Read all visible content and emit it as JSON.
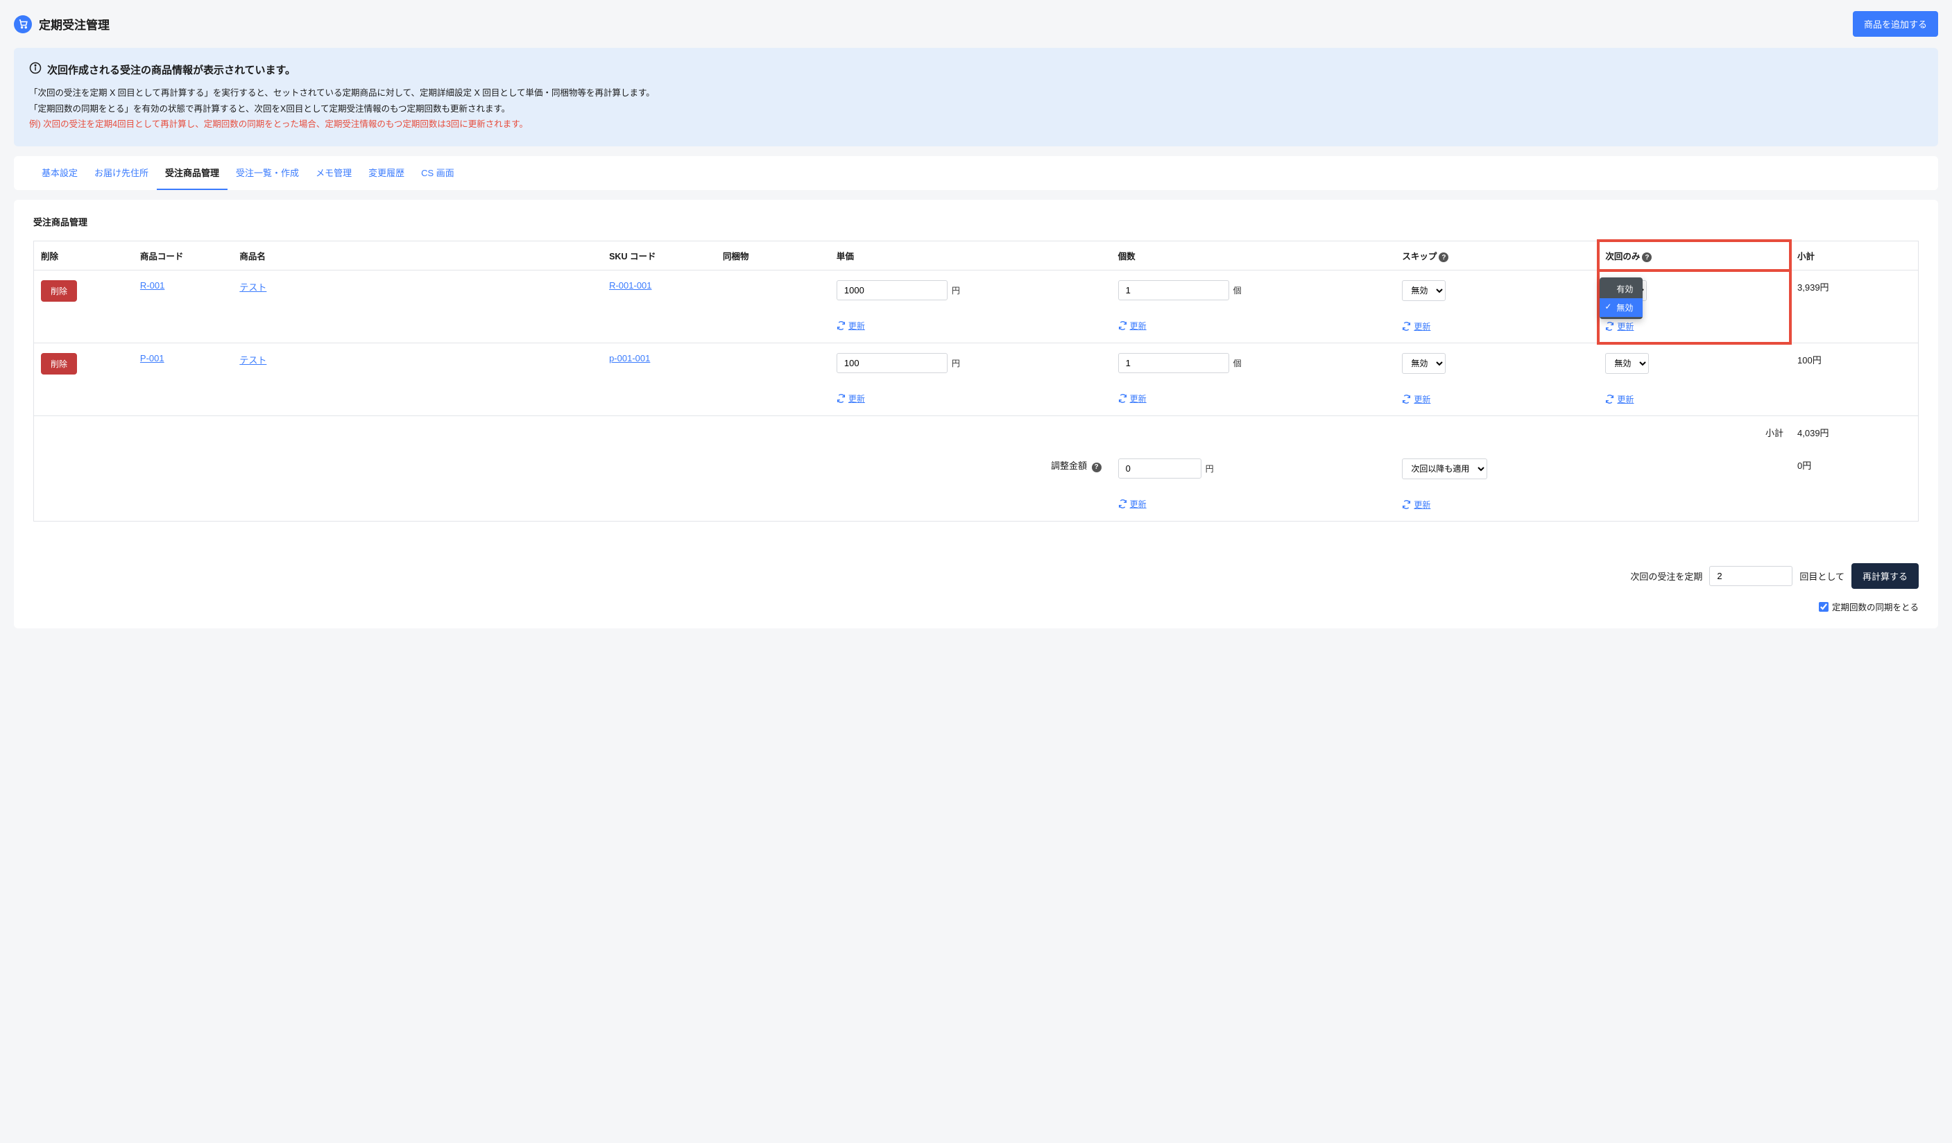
{
  "header": {
    "title": "定期受注管理",
    "add_product_btn": "商品を追加する"
  },
  "info_banner": {
    "title": "次回作成される受注の商品情報が表示されています。",
    "line1": "「次回の受注を定期 X 回目として再計算する」を実行すると、セットされている定期商品に対して、定期詳細設定 X 回目として単価・同梱物等を再計算します。",
    "line2": "「定期回数の同期をとる」を有効の状態で再計算すると、次回をX回目として定期受注情報のもつ定期回数も更新されます。",
    "example": "例) 次回の受注を定期4回目として再計算し、定期回数の同期をとった場合、定期受注情報のもつ定期回数は3回に更新されます。"
  },
  "tabs": {
    "basic": "基本設定",
    "delivery": "お届け先住所",
    "product": "受注商品管理",
    "order_list": "受注一覧・作成",
    "memo": "メモ管理",
    "history": "変更履歴",
    "cs": "CS 画面"
  },
  "section_title": "受注商品管理",
  "table": {
    "headers": {
      "delete": "削除",
      "code": "商品コード",
      "name": "商品名",
      "sku": "SKU コード",
      "bundle": "同梱物",
      "price": "単価",
      "qty": "個数",
      "skip": "スキップ",
      "next_only": "次回のみ",
      "subtotal": "小計"
    },
    "rows": [
      {
        "code": "R-001",
        "name": "テスト",
        "sku": "R-001-001",
        "price": "1000",
        "price_unit": "円",
        "qty": "1",
        "qty_unit": "個",
        "skip": "無効",
        "subtotal": "3,939円"
      },
      {
        "code": "P-001",
        "name": "テスト",
        "sku": "p-001-001",
        "price": "100",
        "price_unit": "円",
        "qty": "1",
        "qty_unit": "個",
        "skip": "無効",
        "next_only": "無効",
        "subtotal": "100円"
      }
    ],
    "delete_btn": "削除",
    "update_link": "更新",
    "subtotal_label": "小計",
    "subtotal_value": "4,039円",
    "adjust_label": "調整金額",
    "adjust_value": "0",
    "adjust_unit": "円",
    "adjust_apply": "次回以降も適用",
    "adjust_total": "0円"
  },
  "dropdown": {
    "opt_enable": "有効",
    "opt_disable": "無効"
  },
  "footer": {
    "prefix": "次回の受注を定期",
    "count_value": "2",
    "suffix": "回目として",
    "recalc_btn": "再計算する",
    "sync_label": "定期回数の同期をとる"
  }
}
